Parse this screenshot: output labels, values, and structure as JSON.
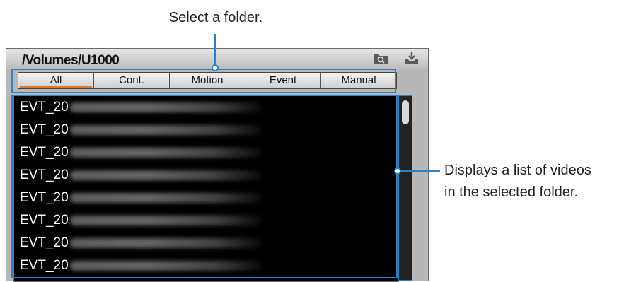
{
  "annotations": {
    "select_folder": "Select a folder.",
    "list_line1": "Displays a list of videos",
    "list_line2": "in the selected folder."
  },
  "window": {
    "path": "/Volumes/U1000",
    "icons": [
      "folder-search-icon",
      "download-icon"
    ]
  },
  "tabs": [
    {
      "label": "All",
      "active": true
    },
    {
      "label": "Cont."
    },
    {
      "label": "Motion"
    },
    {
      "label": "Event"
    },
    {
      "label": "Manual"
    }
  ],
  "files": [
    {
      "prefix": "EVT_20"
    },
    {
      "prefix": "EVT_20"
    },
    {
      "prefix": "EVT_20"
    },
    {
      "prefix": "EVT_20"
    },
    {
      "prefix": "EVT_20"
    },
    {
      "prefix": "EVT_20"
    },
    {
      "prefix": "EVT_20"
    },
    {
      "prefix": "EVT_20"
    }
  ],
  "colors": {
    "callout": "#2e7fc5",
    "active_tab_underline": "#e8741e",
    "list_background": "#000000"
  }
}
